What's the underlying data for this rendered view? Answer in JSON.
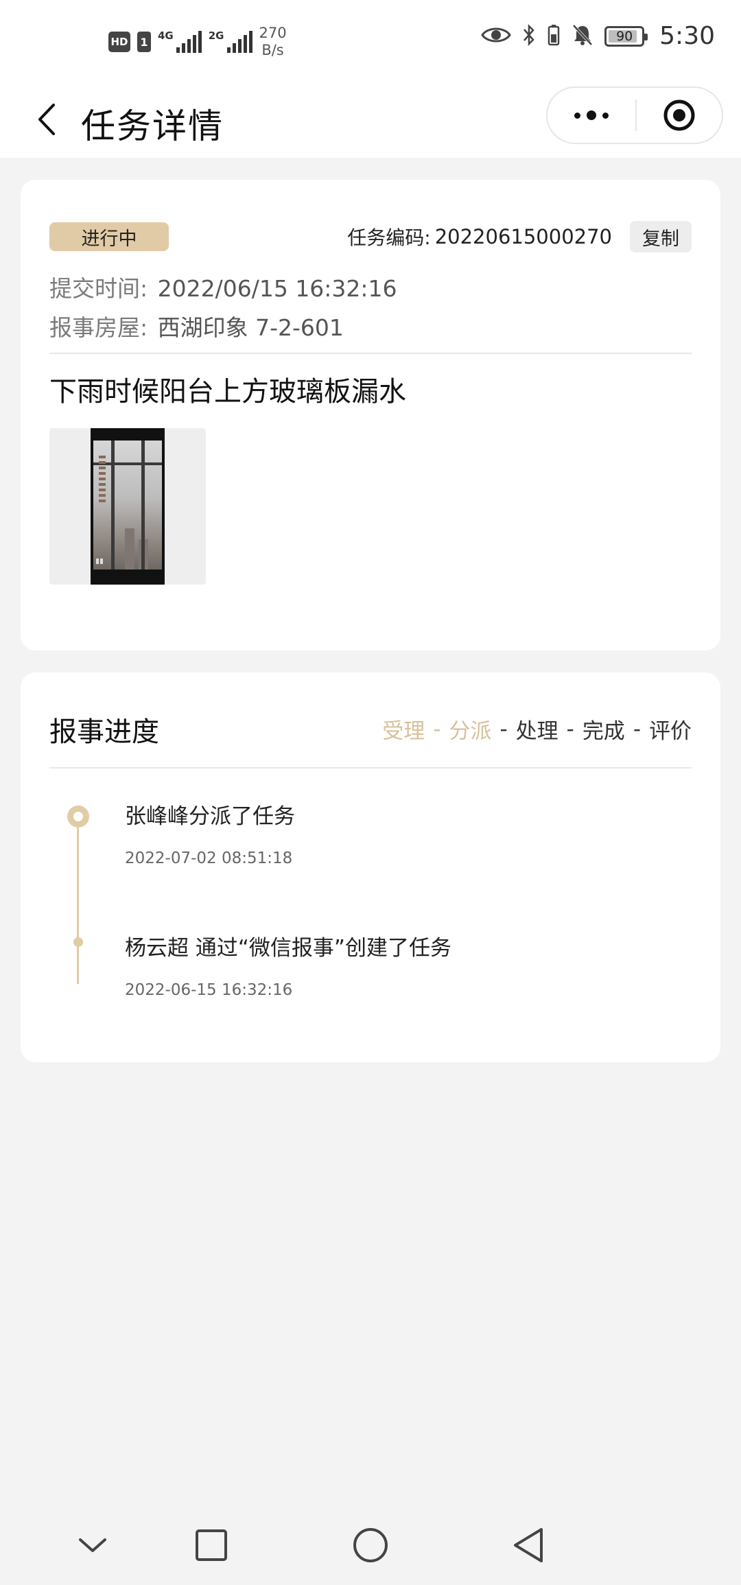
{
  "status_bar": {
    "hd": "HD",
    "sim": "1",
    "net1": "4G",
    "net2": "2G",
    "speed_value": "270",
    "speed_unit": "B/s",
    "battery": "90",
    "time": "5:30"
  },
  "header": {
    "title": "任务详情"
  },
  "task": {
    "status": "进行中",
    "code_label": "任务编码:",
    "code": "20220615000270",
    "copy_label": "复制",
    "submit_label": "提交时间:",
    "submit_time": "2022/06/15 16:32:16",
    "house_label": "报事房屋:",
    "house": "西湖印象 7-2-601",
    "description": "下雨时候阳台上方玻璃板漏水"
  },
  "progress": {
    "title": "报事进度",
    "steps": [
      {
        "label": "受理",
        "active": true
      },
      {
        "label": "分派",
        "active": true
      },
      {
        "label": "处理",
        "active": false
      },
      {
        "label": "完成",
        "active": false
      },
      {
        "label": "评价",
        "active": false
      }
    ],
    "separator": "-",
    "events": [
      {
        "text": "张峰峰分派了任务",
        "time": "2022-07-02 08:51:18"
      },
      {
        "text": "杨云超 通过“微信报事”创建了任务",
        "time": "2022-06-15 16:32:16"
      }
    ]
  },
  "colors": {
    "accent": "#e1cba6",
    "accent_text": "#d8c09a",
    "background": "#f3f3f3"
  }
}
